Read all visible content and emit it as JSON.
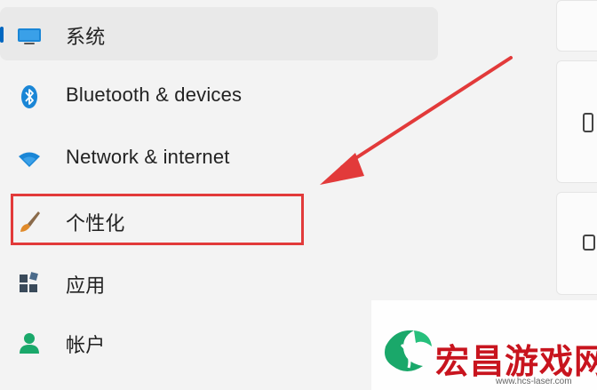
{
  "nav": {
    "items": [
      {
        "label": "系统",
        "icon": "display-icon"
      },
      {
        "label": "Bluetooth & devices",
        "icon": "bluetooth-icon"
      },
      {
        "label": "Network & internet",
        "icon": "wifi-icon"
      },
      {
        "label": "个性化",
        "icon": "brush-icon"
      },
      {
        "label": "应用",
        "icon": "apps-icon"
      },
      {
        "label": "帐户",
        "icon": "account-icon"
      }
    ],
    "selected_index": 0
  },
  "annotation": {
    "highlight_color": "#e23a3a",
    "target": "个性化"
  },
  "watermark": {
    "title": "宏昌游戏网",
    "url": "www.hcs-laser.com",
    "title_color": "#c8141e"
  },
  "colors": {
    "accent": "#0067c0",
    "background": "#f3f3f3",
    "selected_bg": "#e9e9e9"
  }
}
